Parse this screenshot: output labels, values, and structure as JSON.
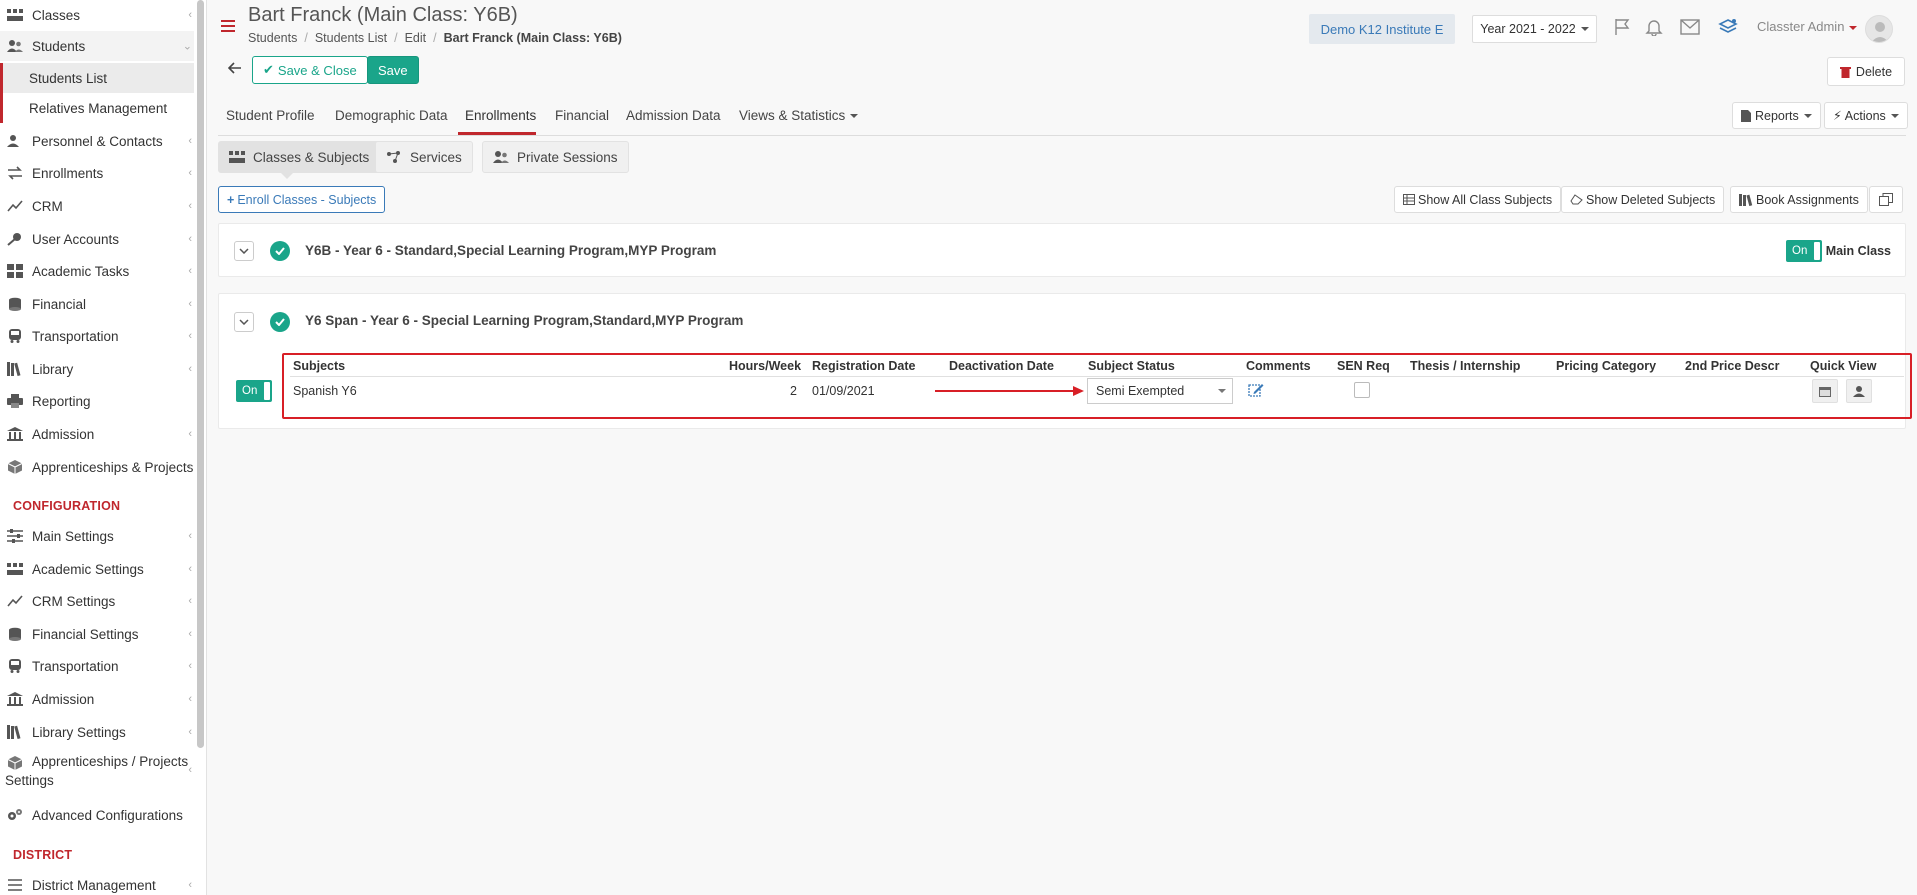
{
  "sidebar": {
    "items": [
      {
        "label": "Classes",
        "icon": "classes-icon"
      },
      {
        "label": "Students",
        "icon": "students-icon"
      },
      {
        "label": "Personnel & Contacts",
        "icon": "personnel-icon"
      },
      {
        "label": "Enrollments",
        "icon": "enrollments-icon"
      },
      {
        "label": "CRM",
        "icon": "crm-icon"
      },
      {
        "label": "User Accounts",
        "icon": "key-icon"
      },
      {
        "label": "Academic Tasks",
        "icon": "tasks-icon"
      },
      {
        "label": "Financial",
        "icon": "coins-icon"
      },
      {
        "label": "Transportation",
        "icon": "bus-icon"
      },
      {
        "label": "Library",
        "icon": "books-icon"
      },
      {
        "label": "Reporting",
        "icon": "printer-icon"
      },
      {
        "label": "Admission",
        "icon": "building-icon"
      },
      {
        "label": "Apprenticeships & Projects",
        "icon": "cube-icon"
      }
    ],
    "sub_items": [
      "Students List",
      "Relatives Management"
    ],
    "config_heading": "CONFIGURATION",
    "config_items": [
      {
        "label": "Main Settings",
        "icon": "sliders-icon"
      },
      {
        "label": "Academic Settings",
        "icon": "classes-icon"
      },
      {
        "label": "CRM Settings",
        "icon": "crm-icon"
      },
      {
        "label": "Financial Settings",
        "icon": "coins-icon"
      },
      {
        "label": "Transportation",
        "icon": "bus-icon"
      },
      {
        "label": "Admission",
        "icon": "building-icon"
      },
      {
        "label": "Library Settings",
        "icon": "books-icon"
      },
      {
        "label": "Apprenticeships / Projects",
        "label2": "Settings",
        "icon": "cube-icon"
      },
      {
        "label": "Advanced Configurations",
        "icon": "gears-icon"
      }
    ],
    "district_heading": "DISTRICT",
    "district_items": [
      {
        "label": "District Management",
        "icon": "list-icon"
      }
    ]
  },
  "header": {
    "title": "Bart Franck (Main Class: Y6B)",
    "breadcrumb": [
      "Students",
      "Students List",
      "Edit",
      "Bart Franck (Main Class: Y6B)"
    ],
    "institute": "Demo K12 Institute E",
    "year": "Year 2021 - 2022",
    "user": "Classter Admin"
  },
  "toolbar": {
    "save_close": "Save & Close",
    "save": "Save",
    "delete": "Delete"
  },
  "tabs": [
    "Student Profile",
    "Demographic Data",
    "Enrollments",
    "Financial",
    "Admission Data",
    "Views & Statistics"
  ],
  "tab_actions": {
    "reports": "Reports",
    "actions": "Actions"
  },
  "subtabs": [
    "Classes & Subjects",
    "Services",
    "Private Sessions"
  ],
  "enroll_btn": "Enroll Classes - Subjects",
  "right_buttons": [
    "Show All Class Subjects",
    "Show Deleted Subjects",
    "Book Assignments"
  ],
  "panels": [
    {
      "title": "Y6B - Year 6 - Standard,Special Learning Program,MYP Program",
      "toggle": "On",
      "main_class": "Main Class"
    },
    {
      "title": "Y6 Span - Year 6 - Special Learning Program,Standard,MYP Program",
      "toggle": "On"
    }
  ],
  "table": {
    "headers": [
      "Subjects",
      "Hours/Week",
      "Registration Date",
      "Deactivation Date",
      "Subject Status",
      "Comments",
      "SEN Req",
      "Thesis / Internship",
      "Pricing Category",
      "2nd Price Descr",
      "Quick View"
    ],
    "row": {
      "subject": "Spanish Y6",
      "hours": "2",
      "registration": "01/09/2021",
      "deactivation": "",
      "status": "Semi Exempted"
    }
  },
  "colors": {
    "accent": "#1aa58a",
    "brand_red": "#c0272d",
    "highlight": "#d81f26",
    "link_blue": "#3a7ab8"
  }
}
